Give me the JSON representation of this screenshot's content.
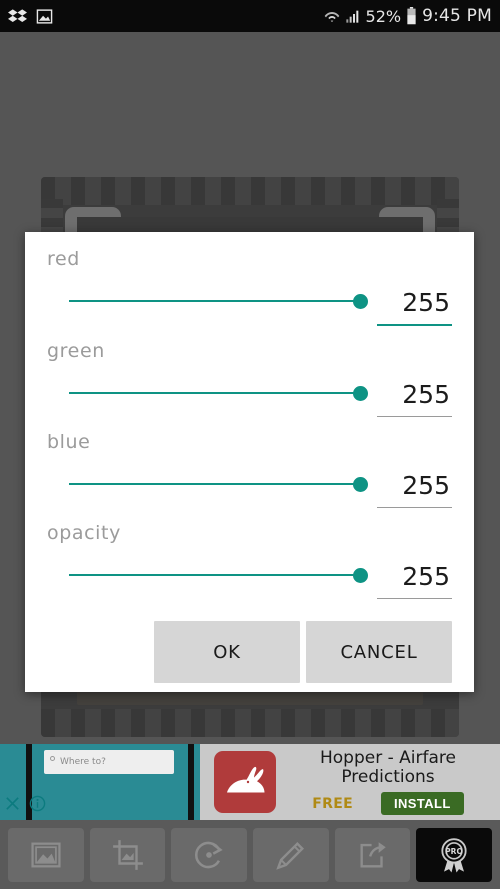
{
  "status_bar": {
    "left_icons": [
      "dropbox-icon",
      "gallery-icon"
    ],
    "wifi_icon": "wifi-icon",
    "signal_icon": "signal-bars-icon",
    "battery_percent": "52%",
    "battery_icon": "battery-icon",
    "time": "9:45 PM"
  },
  "dialog": {
    "accent_color": "#0e9384",
    "rows": [
      {
        "label": "red",
        "value": "255",
        "slider_percent": 100,
        "focused": true
      },
      {
        "label": "green",
        "value": "255",
        "slider_percent": 100,
        "focused": false
      },
      {
        "label": "blue",
        "value": "255",
        "slider_percent": 100,
        "focused": false
      },
      {
        "label": "opacity",
        "value": "255",
        "slider_percent": 100,
        "focused": false
      }
    ],
    "ok_label": "OK",
    "cancel_label": "CANCEL"
  },
  "ad": {
    "title": "Hopper - Airfare Predictions",
    "price_label": "FREE",
    "install_label": "INSTALL",
    "install_color": "#3a6b24",
    "price_color": "#b08a15",
    "app_icon": "rabbit-icon",
    "screenshot_text": "Where to?",
    "close_icon": "close-icon",
    "info_icon": "info-icon"
  },
  "toolbar": {
    "buttons": [
      {
        "icon": "gallery-icon"
      },
      {
        "icon": "crop-icon"
      },
      {
        "icon": "rotate-icon"
      },
      {
        "icon": "pencil-icon"
      },
      {
        "icon": "share-icon"
      },
      {
        "icon": "pro-badge-icon",
        "label": "PRO"
      }
    ]
  }
}
